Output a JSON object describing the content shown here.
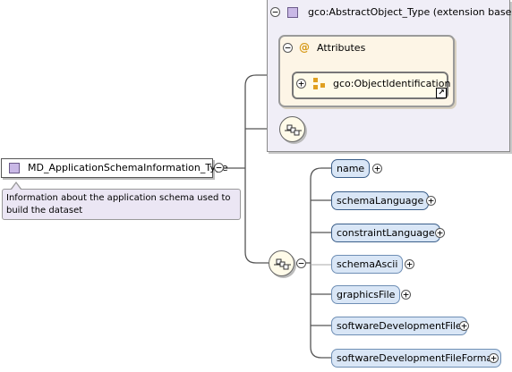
{
  "base_type": {
    "label": "gco:AbstractObject_Type (extension base)"
  },
  "attributes_group": {
    "label": "Attributes",
    "icon": "at-icon"
  },
  "attribute_group_ref": {
    "label": "gco:ObjectIdentification"
  },
  "main_type": {
    "label": "MD_ApplicationSchemaInformation_Type",
    "documentation": "Information about the application schema used to build the dataset"
  },
  "sequence_elements": [
    {
      "label": "name",
      "required": true
    },
    {
      "label": "schemaLanguage",
      "required": true
    },
    {
      "label": "constraintLanguage",
      "required": true
    },
    {
      "label": "schemaAscii",
      "required": false
    },
    {
      "label": "graphicsFile",
      "required": false
    },
    {
      "label": "softwareDevelopmentFile",
      "required": false
    },
    {
      "label": "softwareDevelopmentFileFormat",
      "required": false
    }
  ],
  "colors": {
    "element_fill": "#d9e6f6",
    "base_fill": "#f0eef7",
    "attributes_fill": "#fdf5e6",
    "documentation_fill": "#ebe6f4"
  }
}
